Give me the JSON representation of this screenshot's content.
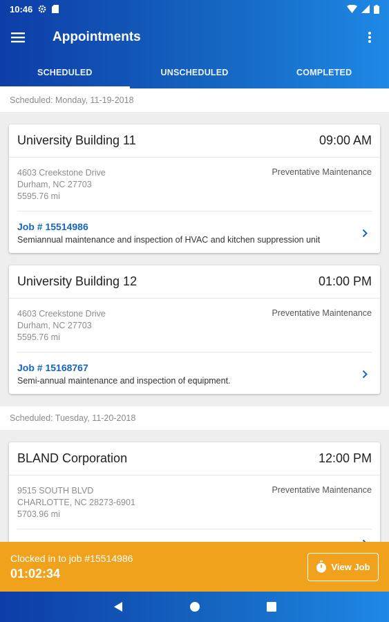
{
  "status_bar": {
    "time": "10:46"
  },
  "app_bar": {
    "title": "Appointments"
  },
  "tabs": [
    {
      "label": "SCHEDULED",
      "active": true
    },
    {
      "label": "UNSCHEDULED",
      "active": false
    },
    {
      "label": "COMPLETED",
      "active": false
    }
  ],
  "sections": [
    {
      "header": "Scheduled: Monday, 11-19-2018",
      "cards": [
        {
          "name": "University Building 11",
          "time": "09:00 AM",
          "address_line1": "4603 Creekstone Drive",
          "address_line2": "Durham, NC 27703",
          "distance": "5595.76 mi",
          "type": "Preventative Maintenance",
          "job_number": "Job # 15514986",
          "description": "Semiannual maintenance and inspection of HVAC and kitchen suppression unit"
        },
        {
          "name": "University Building 12",
          "time": "01:00 PM",
          "address_line1": "4603 Creekstone Drive",
          "address_line2": "Durham, NC 27703",
          "distance": "5595.76 mi",
          "type": "Preventative Maintenance",
          "job_number": "Job # 15168767",
          "description": "Semi-annual maintenance and inspection of equipment."
        }
      ]
    },
    {
      "header": "Scheduled: Tuesday, 11-20-2018",
      "cards": [
        {
          "name": "BLAND Corporation",
          "time": "12:00 PM",
          "address_line1": "9515 SOUTH BLVD",
          "address_line2": "CHARLOTTE, NC 28273-6901",
          "distance": "5703.96 mi",
          "type": "Preventative Maintenance",
          "job_number": "",
          "description": ""
        }
      ]
    }
  ],
  "clock_bar": {
    "label": "Clocked in to job #15514986",
    "timer": "01:02:34",
    "button_label": "View Job"
  },
  "colors": {
    "primary": "#1565c0",
    "accent": "#f0a21d"
  },
  "icons": [
    "menu-icon",
    "more-vert-icon",
    "chevron-right-icon",
    "stopwatch-icon",
    "back-icon",
    "home-icon",
    "recents-icon"
  ]
}
